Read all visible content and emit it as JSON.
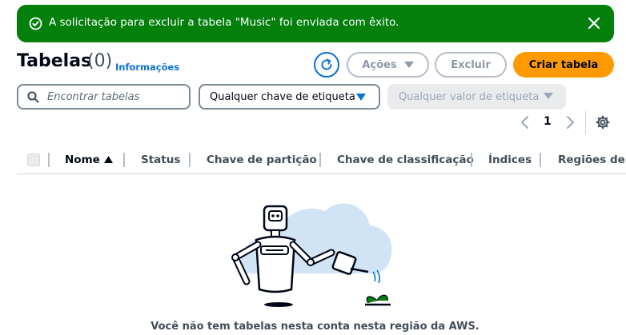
{
  "flash": {
    "message": "A solicitação para excluir a tabela \"Music\" foi enviada com êxito.",
    "icon": "success-check-icon",
    "close_icon": "close-icon",
    "color": "#037f0c"
  },
  "header": {
    "title": "Tabelas",
    "count": "(0)",
    "info_link": "Informações"
  },
  "toolbar": {
    "refresh_icon": "refresh-icon",
    "actions_label": "Ações",
    "delete_label": "Excluir",
    "create_label": "Criar tabela",
    "primary_color": "#ff9900",
    "link_color": "#0972d3"
  },
  "filters": {
    "search_placeholder": "Encontrar tabelas",
    "tag_key_label": "Qualquer chave de etiqueta",
    "tag_value_label": "Qualquer valor de etiqueta"
  },
  "pagination": {
    "current_page": "1"
  },
  "table": {
    "columns": [
      "Nome",
      "Status",
      "Chave de partição",
      "Chave de classificação",
      "Índices",
      "Regiões de"
    ],
    "sort_indicator": "sort-ascending-icon",
    "rows": []
  },
  "empty_state": {
    "message": "Você não tem tabelas nesta conta nesta região da AWS.",
    "illustration": "robot-watering-plant-illustration"
  }
}
